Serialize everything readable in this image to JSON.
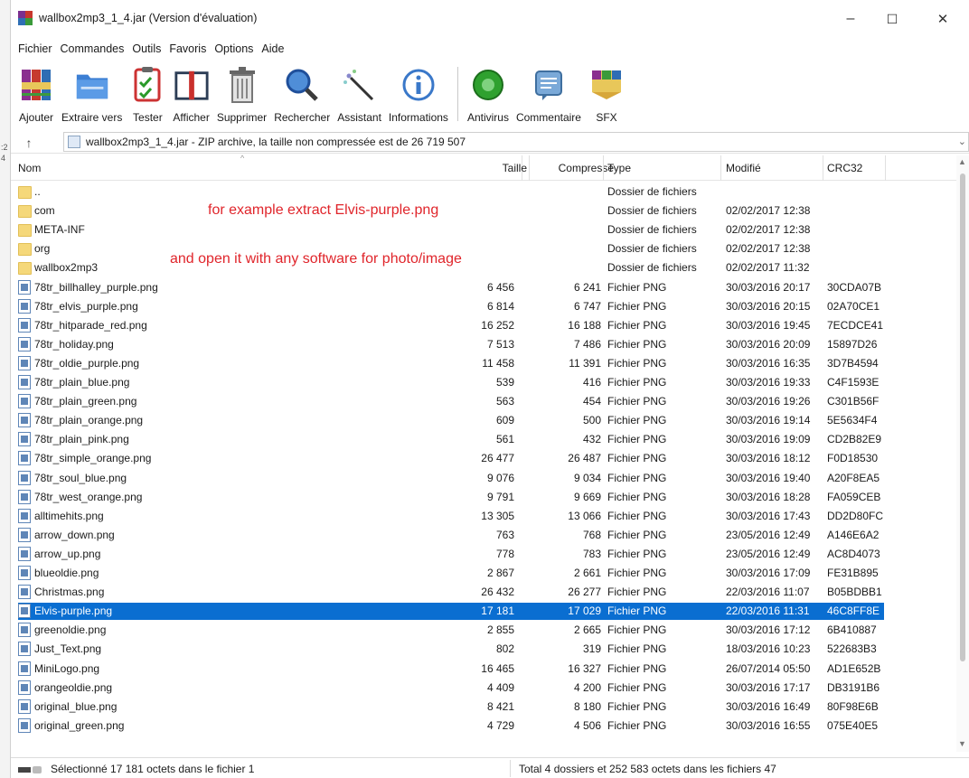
{
  "window": {
    "title": "wallbox2mp3_1_4.jar (Version d'évaluation)",
    "controls": {
      "minimize": "–",
      "maximize": "☐",
      "close": "✕"
    }
  },
  "menu": [
    "Fichier",
    "Commandes",
    "Outils",
    "Favoris",
    "Options",
    "Aide"
  ],
  "toolbar": [
    {
      "label": "Ajouter",
      "icon": "add-books-icon"
    },
    {
      "label": "Extraire vers",
      "icon": "extract-folder-icon"
    },
    {
      "label": "Tester",
      "icon": "test-checklist-icon"
    },
    {
      "label": "Afficher",
      "icon": "view-book-icon"
    },
    {
      "label": "Supprimer",
      "icon": "delete-trash-icon"
    },
    {
      "label": "Rechercher",
      "icon": "search-magnifier-icon"
    },
    {
      "label": "Assistant",
      "icon": "wizard-wand-icon"
    },
    {
      "label": "Informations",
      "icon": "info-icon"
    },
    {
      "label": "Antivirus",
      "icon": "antivirus-icon"
    },
    {
      "label": "Commentaire",
      "icon": "comment-icon"
    },
    {
      "label": "SFX",
      "icon": "sfx-icon"
    }
  ],
  "address": {
    "up": "↑",
    "path": "wallbox2mp3_1_4.jar - ZIP archive, la taille non compressée est de 26 719 507",
    "dropdown": "⌄"
  },
  "columns": {
    "name": "Nom",
    "size": "Taille",
    "compressed": "Compressé",
    "type": "Type",
    "modified": "Modifié",
    "crc": "CRC32"
  },
  "annotations": {
    "line1": "for example extract Elvis-purple.png",
    "line2": "and open it with any software for photo/image"
  },
  "files": [
    {
      "name": "..",
      "size": "",
      "compressed": "",
      "type": "Dossier de fichiers",
      "modified": "",
      "crc": "",
      "kind": "folder",
      "selected": false
    },
    {
      "name": "com",
      "size": "",
      "compressed": "",
      "type": "Dossier de fichiers",
      "modified": "02/02/2017 12:38",
      "crc": "",
      "kind": "folder",
      "selected": false
    },
    {
      "name": "META-INF",
      "size": "",
      "compressed": "",
      "type": "Dossier de fichiers",
      "modified": "02/02/2017 12:38",
      "crc": "",
      "kind": "folder",
      "selected": false
    },
    {
      "name": "org",
      "size": "",
      "compressed": "",
      "type": "Dossier de fichiers",
      "modified": "02/02/2017 12:38",
      "crc": "",
      "kind": "folder",
      "selected": false
    },
    {
      "name": "wallbox2mp3",
      "size": "",
      "compressed": "",
      "type": "Dossier de fichiers",
      "modified": "02/02/2017 11:32",
      "crc": "",
      "kind": "folder",
      "selected": false
    },
    {
      "name": "78tr_billhalley_purple.png",
      "size": "6 456",
      "compressed": "6 241",
      "type": "Fichier PNG",
      "modified": "30/03/2016 20:17",
      "crc": "30CDA07B",
      "kind": "png",
      "selected": false
    },
    {
      "name": "78tr_elvis_purple.png",
      "size": "6 814",
      "compressed": "6 747",
      "type": "Fichier PNG",
      "modified": "30/03/2016 20:15",
      "crc": "02A70CE1",
      "kind": "png",
      "selected": false
    },
    {
      "name": "78tr_hitparade_red.png",
      "size": "16 252",
      "compressed": "16 188",
      "type": "Fichier PNG",
      "modified": "30/03/2016 19:45",
      "crc": "7ECDCE41",
      "kind": "png",
      "selected": false
    },
    {
      "name": "78tr_holiday.png",
      "size": "7 513",
      "compressed": "7 486",
      "type": "Fichier PNG",
      "modified": "30/03/2016 20:09",
      "crc": "15897D26",
      "kind": "png",
      "selected": false
    },
    {
      "name": "78tr_oldie_purple.png",
      "size": "11 458",
      "compressed": "11 391",
      "type": "Fichier PNG",
      "modified": "30/03/2016 16:35",
      "crc": "3D7B4594",
      "kind": "png",
      "selected": false
    },
    {
      "name": "78tr_plain_blue.png",
      "size": "539",
      "compressed": "416",
      "type": "Fichier PNG",
      "modified": "30/03/2016 19:33",
      "crc": "C4F1593E",
      "kind": "png",
      "selected": false
    },
    {
      "name": "78tr_plain_green.png",
      "size": "563",
      "compressed": "454",
      "type": "Fichier PNG",
      "modified": "30/03/2016 19:26",
      "crc": "C301B56F",
      "kind": "png",
      "selected": false
    },
    {
      "name": "78tr_plain_orange.png",
      "size": "609",
      "compressed": "500",
      "type": "Fichier PNG",
      "modified": "30/03/2016 19:14",
      "crc": "5E5634F4",
      "kind": "png",
      "selected": false
    },
    {
      "name": "78tr_plain_pink.png",
      "size": "561",
      "compressed": "432",
      "type": "Fichier PNG",
      "modified": "30/03/2016 19:09",
      "crc": "CD2B82E9",
      "kind": "png",
      "selected": false
    },
    {
      "name": "78tr_simple_orange.png",
      "size": "26 477",
      "compressed": "26 487",
      "type": "Fichier PNG",
      "modified": "30/03/2016 18:12",
      "crc": "F0D18530",
      "kind": "png",
      "selected": false
    },
    {
      "name": "78tr_soul_blue.png",
      "size": "9 076",
      "compressed": "9 034",
      "type": "Fichier PNG",
      "modified": "30/03/2016 19:40",
      "crc": "A20F8EA5",
      "kind": "png",
      "selected": false
    },
    {
      "name": "78tr_west_orange.png",
      "size": "9 791",
      "compressed": "9 669",
      "type": "Fichier PNG",
      "modified": "30/03/2016 18:28",
      "crc": "FA059CEB",
      "kind": "png",
      "selected": false
    },
    {
      "name": "alltimehits.png",
      "size": "13 305",
      "compressed": "13 066",
      "type": "Fichier PNG",
      "modified": "30/03/2016 17:43",
      "crc": "DD2D80FC",
      "kind": "png",
      "selected": false
    },
    {
      "name": "arrow_down.png",
      "size": "763",
      "compressed": "768",
      "type": "Fichier PNG",
      "modified": "23/05/2016 12:49",
      "crc": "A146E6A2",
      "kind": "png",
      "selected": false
    },
    {
      "name": "arrow_up.png",
      "size": "778",
      "compressed": "783",
      "type": "Fichier PNG",
      "modified": "23/05/2016 12:49",
      "crc": "AC8D4073",
      "kind": "png",
      "selected": false
    },
    {
      "name": "blueoldie.png",
      "size": "2 867",
      "compressed": "2 661",
      "type": "Fichier PNG",
      "modified": "30/03/2016 17:09",
      "crc": "FE31B895",
      "kind": "png",
      "selected": false
    },
    {
      "name": "Christmas.png",
      "size": "26 432",
      "compressed": "26 277",
      "type": "Fichier PNG",
      "modified": "22/03/2016 11:07",
      "crc": "B05BDBB1",
      "kind": "png",
      "selected": false
    },
    {
      "name": "Elvis-purple.png",
      "size": "17 181",
      "compressed": "17 029",
      "type": "Fichier PNG",
      "modified": "22/03/2016 11:31",
      "crc": "46C8FF8E",
      "kind": "png",
      "selected": true
    },
    {
      "name": "greenoldie.png",
      "size": "2 855",
      "compressed": "2 665",
      "type": "Fichier PNG",
      "modified": "30/03/2016 17:12",
      "crc": "6B410887",
      "kind": "png",
      "selected": false
    },
    {
      "name": "Just_Text.png",
      "size": "802",
      "compressed": "319",
      "type": "Fichier PNG",
      "modified": "18/03/2016 10:23",
      "crc": "522683B3",
      "kind": "png",
      "selected": false
    },
    {
      "name": "MiniLogo.png",
      "size": "16 465",
      "compressed": "16 327",
      "type": "Fichier PNG",
      "modified": "26/07/2014 05:50",
      "crc": "AD1E652B",
      "kind": "png",
      "selected": false
    },
    {
      "name": "orangeoldie.png",
      "size": "4 409",
      "compressed": "4 200",
      "type": "Fichier PNG",
      "modified": "30/03/2016 17:17",
      "crc": "DB3191B6",
      "kind": "png",
      "selected": false
    },
    {
      "name": "original_blue.png",
      "size": "8 421",
      "compressed": "8 180",
      "type": "Fichier PNG",
      "modified": "30/03/2016 16:49",
      "crc": "80F98E6B",
      "kind": "png",
      "selected": false
    },
    {
      "name": "original_green.png",
      "size": "4 729",
      "compressed": "4 506",
      "type": "Fichier PNG",
      "modified": "30/03/2016 16:55",
      "crc": "075E40E5",
      "kind": "png",
      "selected": false
    }
  ],
  "status": {
    "left": "Sélectionné 17 181 octets dans le fichier 1",
    "right": "Total 4 dossiers et 252 583 octets dans les fichiers 47"
  },
  "colors": {
    "selection": "#0a6ed1",
    "annotation": "#e0252b",
    "folder": "#f5d87a"
  }
}
